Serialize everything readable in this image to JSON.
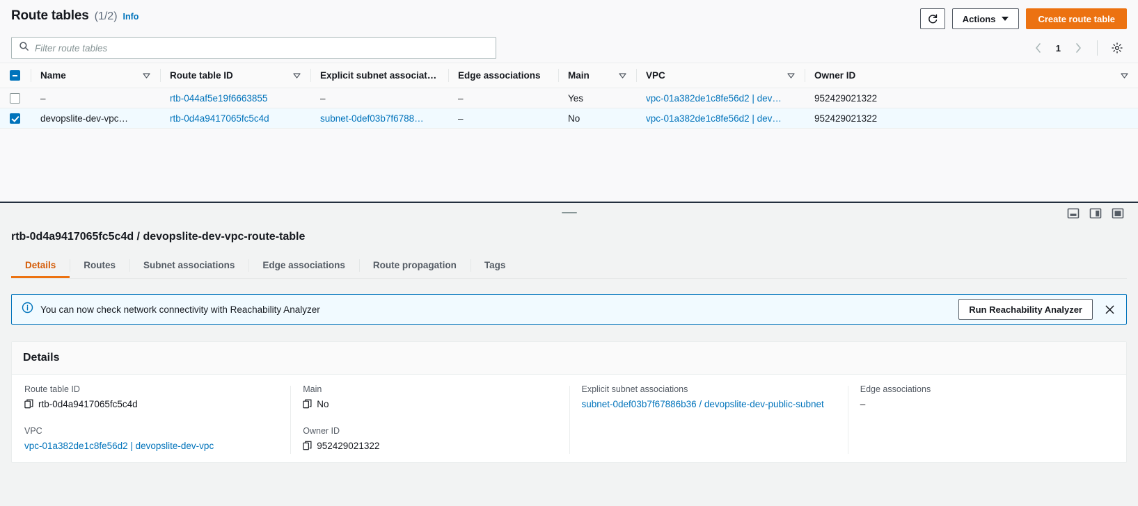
{
  "header": {
    "title": "Route tables",
    "count": "(1/2)",
    "info_label": "Info",
    "refresh_icon": "refresh-icon",
    "actions_label": "Actions",
    "create_label": "Create route table"
  },
  "filter": {
    "placeholder": "Filter route tables",
    "search_icon": "search-icon",
    "page_number": "1",
    "prev_icon": "chevron-left-icon",
    "next_icon": "chevron-right-icon",
    "settings_icon": "gear-icon"
  },
  "table": {
    "columns": [
      {
        "label": "Name",
        "sortable": true
      },
      {
        "label": "Route table ID",
        "sortable": true
      },
      {
        "label": "Explicit subnet associat…",
        "sortable": false
      },
      {
        "label": "Edge associations",
        "sortable": false
      },
      {
        "label": "Main",
        "sortable": true
      },
      {
        "label": "VPC",
        "sortable": true
      },
      {
        "label": "Owner ID",
        "sortable": true
      }
    ],
    "rows": [
      {
        "selected": false,
        "name": "–",
        "route_table_id": "rtb-044af5e19f6663855",
        "explicit_subnet": "–",
        "edge_associations": "–",
        "main": "Yes",
        "vpc": "vpc-01a382de1c8fe56d2 | dev…",
        "owner_id": "952429021322"
      },
      {
        "selected": true,
        "name": "devopslite-dev-vpc…",
        "route_table_id": "rtb-0d4a9417065fc5c4d",
        "explicit_subnet": "subnet-0def03b7f6788…",
        "edge_associations": "–",
        "main": "No",
        "vpc": "vpc-01a382de1c8fe56d2 | dev…",
        "owner_id": "952429021322"
      }
    ]
  },
  "split": {
    "drag_handle": "resize-handle",
    "view_icons": [
      "split-bottom-view-icon",
      "split-side-view-icon",
      "full-page-view-icon"
    ]
  },
  "detail": {
    "title": "rtb-0d4a9417065fc5c4d / devopslite-dev-vpc-route-table",
    "tabs": [
      {
        "label": "Details",
        "active": true
      },
      {
        "label": "Routes",
        "active": false
      },
      {
        "label": "Subnet associations",
        "active": false
      },
      {
        "label": "Edge associations",
        "active": false
      },
      {
        "label": "Route propagation",
        "active": false
      },
      {
        "label": "Tags",
        "active": false
      }
    ],
    "alert": {
      "icon": "info-circle-icon",
      "text": "You can now check network connectivity with Reachability Analyzer",
      "button_label": "Run Reachability Analyzer",
      "close_icon": "close-icon"
    },
    "card_title": "Details",
    "fields": {
      "route_table_id_label": "Route table ID",
      "route_table_id_value": "rtb-0d4a9417065fc5c4d",
      "vpc_label": "VPC",
      "vpc_value": "vpc-01a382de1c8fe56d2 | devopslite-dev-vpc",
      "main_label": "Main",
      "main_value": "No",
      "owner_id_label": "Owner ID",
      "owner_id_value": "952429021322",
      "explicit_subnet_label": "Explicit subnet associations",
      "explicit_subnet_value": "subnet-0def03b7f67886b36 / devopslite-dev-public-subnet",
      "edge_assoc_label": "Edge associations",
      "edge_assoc_value": "–"
    },
    "copy_icon": "copy-icon"
  },
  "colors": {
    "accent_orange": "#ec7211",
    "link_blue": "#0073bb",
    "selected_row_bg": "#f1faff",
    "selected_row_border": "#00a1c9"
  }
}
